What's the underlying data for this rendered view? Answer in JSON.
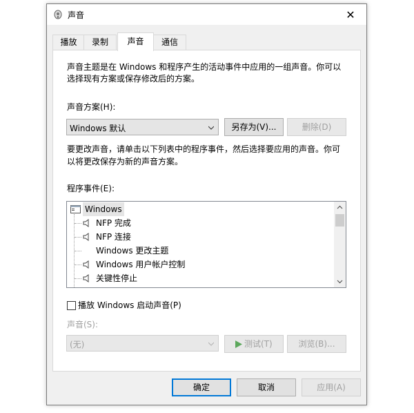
{
  "window": {
    "title": "声音",
    "close_glyph": "✕"
  },
  "tabs": [
    {
      "label": "播放"
    },
    {
      "label": "录制"
    },
    {
      "label": "声音"
    },
    {
      "label": "通信"
    }
  ],
  "sound_page": {
    "intro_line1": "声音主题是在 Windows 和程序产生的活动事件中应用的一组声音。你可以",
    "intro_line2": "选择现有方案或保存修改后的方案。",
    "scheme_label": "声音方案(H):",
    "scheme_value": "Windows 默认",
    "save_as_label": "另存为(V)...",
    "delete_label": "删除(D)",
    "change_line1": "要更改声音，请单击以下列表中的程序事件，然后选择要应用的声音。你可",
    "change_line2": "以将更改保存为新的声音方案。",
    "events_label": "程序事件(E):",
    "events_root": "Windows",
    "events": [
      {
        "label": "NFP 完成",
        "has_sound": true
      },
      {
        "label": "NFP 连接",
        "has_sound": true
      },
      {
        "label": "Windows 更改主题",
        "has_sound": false
      },
      {
        "label": "Windows 用户帐户控制",
        "has_sound": true
      },
      {
        "label": "关键性停止",
        "has_sound": true
      }
    ],
    "startup_checkbox_label": "播放 Windows 启动声音(P)",
    "startup_checked": false,
    "sound_label": "声音(S):",
    "sound_value": "(无)",
    "test_label": "测试(T)",
    "browse_label": "浏览(B)..."
  },
  "footer": {
    "ok_label": "确定",
    "cancel_label": "取消",
    "apply_label": "应用(A)"
  },
  "colors": {
    "focus_border": "#0078d7",
    "disabled_text": "#a0a0a0",
    "test_play_icon": "#5ca85c"
  }
}
